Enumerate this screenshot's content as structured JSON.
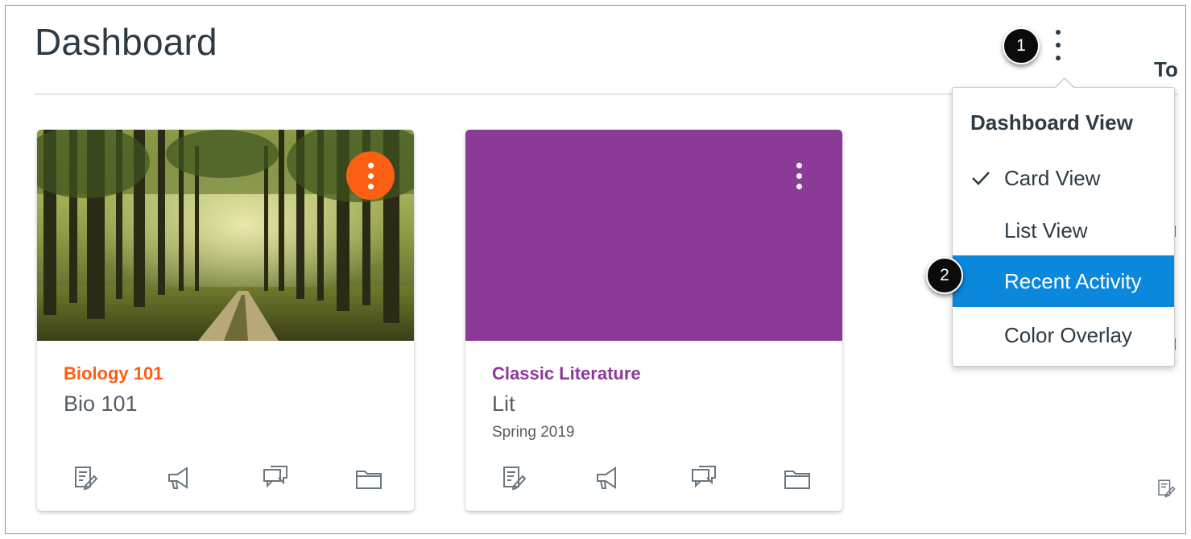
{
  "page": {
    "title": "Dashboard",
    "right_heading": "To"
  },
  "callouts": {
    "first": "1",
    "second": "2"
  },
  "dashboard_menu": {
    "heading": "Dashboard View",
    "items": [
      {
        "label": "Card View",
        "checked": true,
        "highlighted": false
      },
      {
        "label": "List View",
        "checked": false,
        "highlighted": false
      },
      {
        "label": "Recent Activity",
        "checked": false,
        "highlighted": true
      },
      {
        "label": "Color Overlay",
        "checked": false,
        "highlighted": false
      }
    ]
  },
  "cards": [
    {
      "name": "Biology 101",
      "code": "Bio 101",
      "term": "",
      "color": "#fc5e13",
      "hero": "forest-image",
      "icons": [
        "assignments-icon",
        "announcements-icon",
        "discussions-icon",
        "files-icon"
      ]
    },
    {
      "name": "Classic Literature",
      "code": "Lit",
      "term": "Spring 2019",
      "color": "#8b3a98",
      "hero": "solid-color",
      "icons": [
        "assignments-icon",
        "announcements-icon",
        "discussions-icon",
        "files-icon"
      ]
    }
  ],
  "colors": {
    "text": "#2d3b45",
    "menu_highlight": "#0b87dc",
    "callout": "#0b0b0b"
  }
}
